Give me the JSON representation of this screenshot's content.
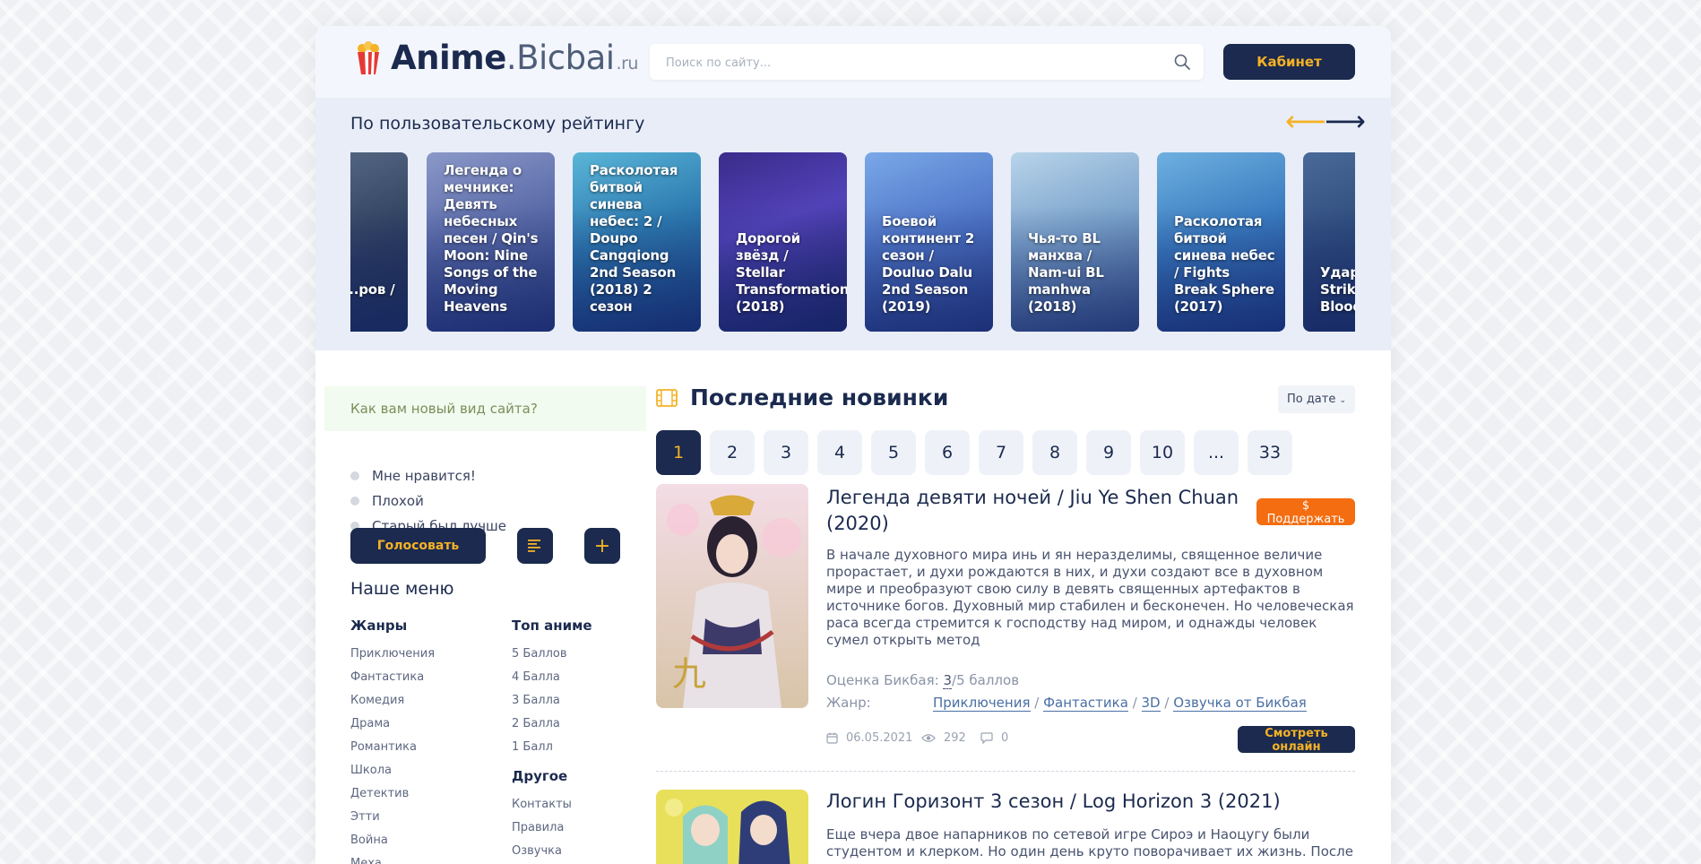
{
  "header": {
    "logo_main": "Anime",
    "logo_dot": ".",
    "logo_sub": "Bicbai",
    "logo_tld": ".ru",
    "search_placeholder": "Поиск по сайту...",
    "cabinet_label": "Кабинет"
  },
  "carousel": {
    "title": "По пользовательскому рейтингу",
    "prev_icon": "arrow-left-icon",
    "next_icon": "arrow-right-icon",
    "cards": [
      {
        "title": "...лин ...ров / ...hu"
      },
      {
        "title": "Легенда о мечнике: Девять небесных песен / Qin's Moon: Nine Songs of the Moving Heavens"
      },
      {
        "title": "Расколотая битвой синева небес: 2 / Doupo Cangqiong 2nd Season (2018) 2 сезон"
      },
      {
        "title": "Дорогой звёзд / Stellar Transformations (2018)"
      },
      {
        "title": "Боевой континент 2 сезон / Douluo Dalu 2nd Season (2019)"
      },
      {
        "title": "Чья-то BL манхва / Nam-ui BL manhwa (2018)"
      },
      {
        "title": "Расколотая битвой синева небес / Fights Break Sphere (2017)"
      },
      {
        "title": "Удар... Strike... Blood..."
      }
    ]
  },
  "poll": {
    "question": "Как вам новый вид сайта?",
    "options": [
      "Мне нравится!",
      "Плохой",
      "Старый был лучше"
    ],
    "vote_label": "Голосовать"
  },
  "menu": {
    "title": "Наше меню",
    "genres_head": "Жанры",
    "genres": [
      "Приключения",
      "Фантастика",
      "Комедия",
      "Драма",
      "Романтика",
      "Школа",
      "Детектив",
      "Этти",
      "Война",
      "Меха"
    ],
    "top_head": "Топ аниме",
    "top": [
      "5 Баллов",
      "4 Балла",
      "3 Балла",
      "2 Балла",
      "1 Балл"
    ],
    "other_head": "Другое",
    "other": [
      "Контакты",
      "Правила",
      "Озвучка"
    ]
  },
  "main": {
    "title": "Последние новинки",
    "sort_label": "По дате",
    "pages": [
      "1",
      "2",
      "3",
      "4",
      "5",
      "6",
      "7",
      "8",
      "9",
      "10",
      "...",
      "33"
    ],
    "item1": {
      "title": "Легенда девяти ночей / Jiu Ye Shen Chuan (2020)",
      "support_label": "$ Поддержать",
      "description": "В начале духовного мира инь и ян неразделимы, священное величие прорастает, и духи рождаются в них, и духи создают все в духовном мире и преобразуют свою силу в девять священных артефактов в источнике богов. Духовный мир стабилен и бесконечен. Но человеческая раса всегда стремится к господству над миром, и однажды человек сумел открыть метод",
      "rating_label": "Оценка Бикбая:",
      "rating_value": "3",
      "rating_suffix": "/5 баллов",
      "genre_label": "Жанр:",
      "genres": [
        "Приключения",
        "Фантастика",
        "3D",
        "Озвучка от Бикбая"
      ],
      "date": "06.05.2021",
      "views": "292",
      "comments": "0",
      "watch_label": "Смотреть онлайн"
    },
    "item2": {
      "title": "Логин Горизонт 3 сезон / Log Horizon 3 (2021)",
      "description": "Еще вчера двое напарников по сетевой игре Сироэ и Наоцугу были студентом и клерком. Но один день круто поворачивает их жизнь. После"
    }
  },
  "colors": {
    "navy": "#1b2a4e",
    "accent": "#f5b226",
    "support": "#f46d10"
  }
}
